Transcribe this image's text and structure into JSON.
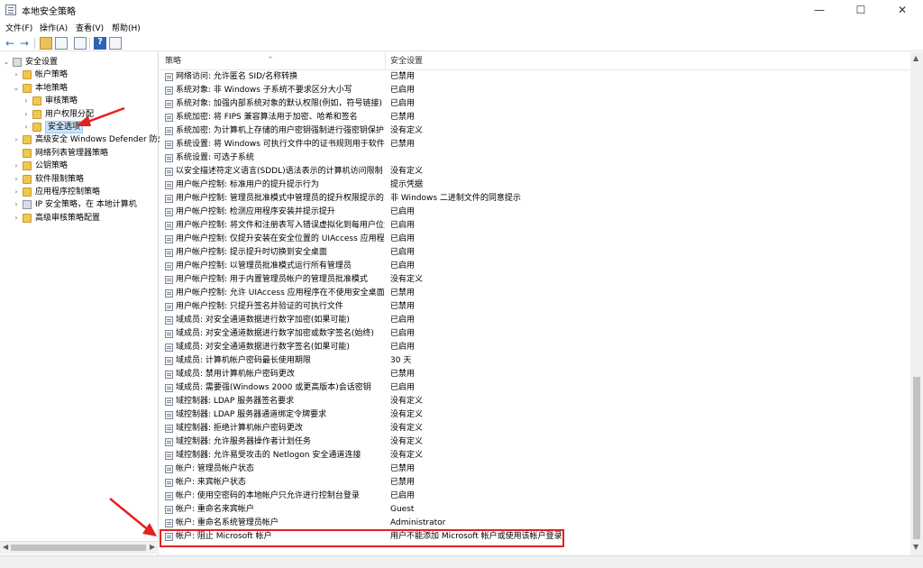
{
  "window": {
    "title": "本地安全策略",
    "controls": {
      "minimize": "—",
      "maximize": "☐",
      "close": "✕"
    }
  },
  "menu": [
    "文件(F)",
    "操作(A)",
    "查看(V)",
    "帮助(H)"
  ],
  "toolbar": {
    "icons": [
      "back-arrow-icon",
      "forward-arrow-icon",
      "up-folder-icon",
      "show-hide-tree-icon",
      "export-list-icon",
      "help-icon",
      "properties-icon"
    ],
    "back": "←",
    "forward": "→",
    "help": "?"
  },
  "tree": [
    {
      "label": "安全设置",
      "level": 0,
      "expander": "⌄",
      "icon": "shield"
    },
    {
      "label": "帐户策略",
      "level": 1,
      "expander": "›",
      "icon": "folder"
    },
    {
      "label": "本地策略",
      "level": 1,
      "expander": "⌄",
      "icon": "folder"
    },
    {
      "label": "审核策略",
      "level": 2,
      "expander": "›",
      "icon": "folder"
    },
    {
      "label": "用户权限分配",
      "level": 2,
      "expander": "›",
      "icon": "folder"
    },
    {
      "label": "安全选项",
      "level": 2,
      "expander": "›",
      "icon": "folder",
      "selected": true
    },
    {
      "label": "高级安全 Windows Defender 防火墙",
      "level": 1,
      "expander": "›",
      "icon": "folder"
    },
    {
      "label": "网络列表管理器策略",
      "level": 1,
      "expander": "",
      "icon": "folder"
    },
    {
      "label": "公钥策略",
      "level": 1,
      "expander": "›",
      "icon": "folder"
    },
    {
      "label": "软件限制策略",
      "level": 1,
      "expander": "›",
      "icon": "folder"
    },
    {
      "label": "应用程序控制策略",
      "level": 1,
      "expander": "›",
      "icon": "folder"
    },
    {
      "label": "IP 安全策略，在 本地计算机",
      "level": 1,
      "expander": "›",
      "icon": "shield"
    },
    {
      "label": "高级审核策略配置",
      "level": 1,
      "expander": "›",
      "icon": "folder"
    }
  ],
  "columns": {
    "policy": "策略",
    "setting": "安全设置",
    "sort_caret": "^"
  },
  "rows": [
    {
      "policy": "网络访问: 允许匿名 SID/名称转换",
      "setting": "已禁用"
    },
    {
      "policy": "系统对象: 非 Windows 子系统不要求区分大小写",
      "setting": "已启用"
    },
    {
      "policy": "系统对象: 加强内部系统对象的默认权限(例如，符号链接)",
      "setting": "已启用"
    },
    {
      "policy": "系统加密: 将 FIPS 兼容算法用于加密、哈希和签名",
      "setting": "已禁用"
    },
    {
      "policy": "系统加密: 为计算机上存储的用户密钥强制进行强密钥保护",
      "setting": "没有定义"
    },
    {
      "policy": "系统设置: 将 Windows 可执行文件中的证书规则用于软件...",
      "setting": "已禁用"
    },
    {
      "policy": "系统设置: 可选子系统",
      "setting": ""
    },
    {
      "policy": "以安全描述符定义语言(SDDL)语法表示的计算机访问限制",
      "setting": "没有定义"
    },
    {
      "policy": "用户帐户控制: 标准用户的提升提示行为",
      "setting": "提示凭据"
    },
    {
      "policy": "用户帐户控制: 管理员批准模式中管理员的提升权限提示的...",
      "setting": "非 Windows 二进制文件的同意提示"
    },
    {
      "policy": "用户帐户控制: 检测应用程序安装并提示提升",
      "setting": "已启用"
    },
    {
      "policy": "用户帐户控制: 将文件和注册表写入错误虚拟化到每用户位置",
      "setting": "已启用"
    },
    {
      "policy": "用户帐户控制: 仅提升安装在安全位置的 UIAccess 应用程序",
      "setting": "已启用"
    },
    {
      "policy": "用户帐户控制: 提示提升时切换到安全桌面",
      "setting": "已启用"
    },
    {
      "policy": "用户帐户控制: 以管理员批准模式运行所有管理员",
      "setting": "已启用"
    },
    {
      "policy": "用户帐户控制: 用于内置管理员帐户的管理员批准模式",
      "setting": "没有定义"
    },
    {
      "policy": "用户帐户控制: 允许 UIAccess 应用程序在不使用安全桌面...",
      "setting": "已禁用"
    },
    {
      "policy": "用户帐户控制: 只提升签名并验证的可执行文件",
      "setting": "已禁用"
    },
    {
      "policy": "域成员: 对安全通道数据进行数字加密(如果可能)",
      "setting": "已启用"
    },
    {
      "policy": "域成员: 对安全通道数据进行数字加密或数字签名(始终)",
      "setting": "已启用"
    },
    {
      "policy": "域成员: 对安全通道数据进行数字签名(如果可能)",
      "setting": "已启用"
    },
    {
      "policy": "域成员: 计算机帐户密码最长使用期限",
      "setting": "30 天"
    },
    {
      "policy": "域成员: 禁用计算机帐户密码更改",
      "setting": "已禁用"
    },
    {
      "policy": "域成员: 需要强(Windows 2000 或更高版本)会话密钥",
      "setting": "已启用"
    },
    {
      "policy": "域控制器: LDAP 服务器签名要求",
      "setting": "没有定义"
    },
    {
      "policy": "域控制器: LDAP 服务器通道绑定令牌要求",
      "setting": "没有定义"
    },
    {
      "policy": "域控制器: 拒绝计算机帐户密码更改",
      "setting": "没有定义"
    },
    {
      "policy": "域控制器: 允许服务器操作者计划任务",
      "setting": "没有定义"
    },
    {
      "policy": "域控制器: 允许易受攻击的 Netlogon 安全通道连接",
      "setting": "没有定义"
    },
    {
      "policy": "帐户: 管理员帐户状态",
      "setting": "已禁用"
    },
    {
      "policy": "帐户: 来宾帐户状态",
      "setting": "已禁用"
    },
    {
      "policy": "帐户: 使用空密码的本地帐户只允许进行控制台登录",
      "setting": "已启用"
    },
    {
      "policy": "帐户: 重命名来宾帐户",
      "setting": "Guest"
    },
    {
      "policy": "帐户: 重命名系统管理员帐户",
      "setting": "Administrator"
    },
    {
      "policy": "帐户: 阻止 Microsoft 帐户",
      "setting": "用户不能添加 Microsoft 帐户或使用该帐户登录",
      "highlighted": true
    }
  ],
  "annotation_color": "#e52020"
}
